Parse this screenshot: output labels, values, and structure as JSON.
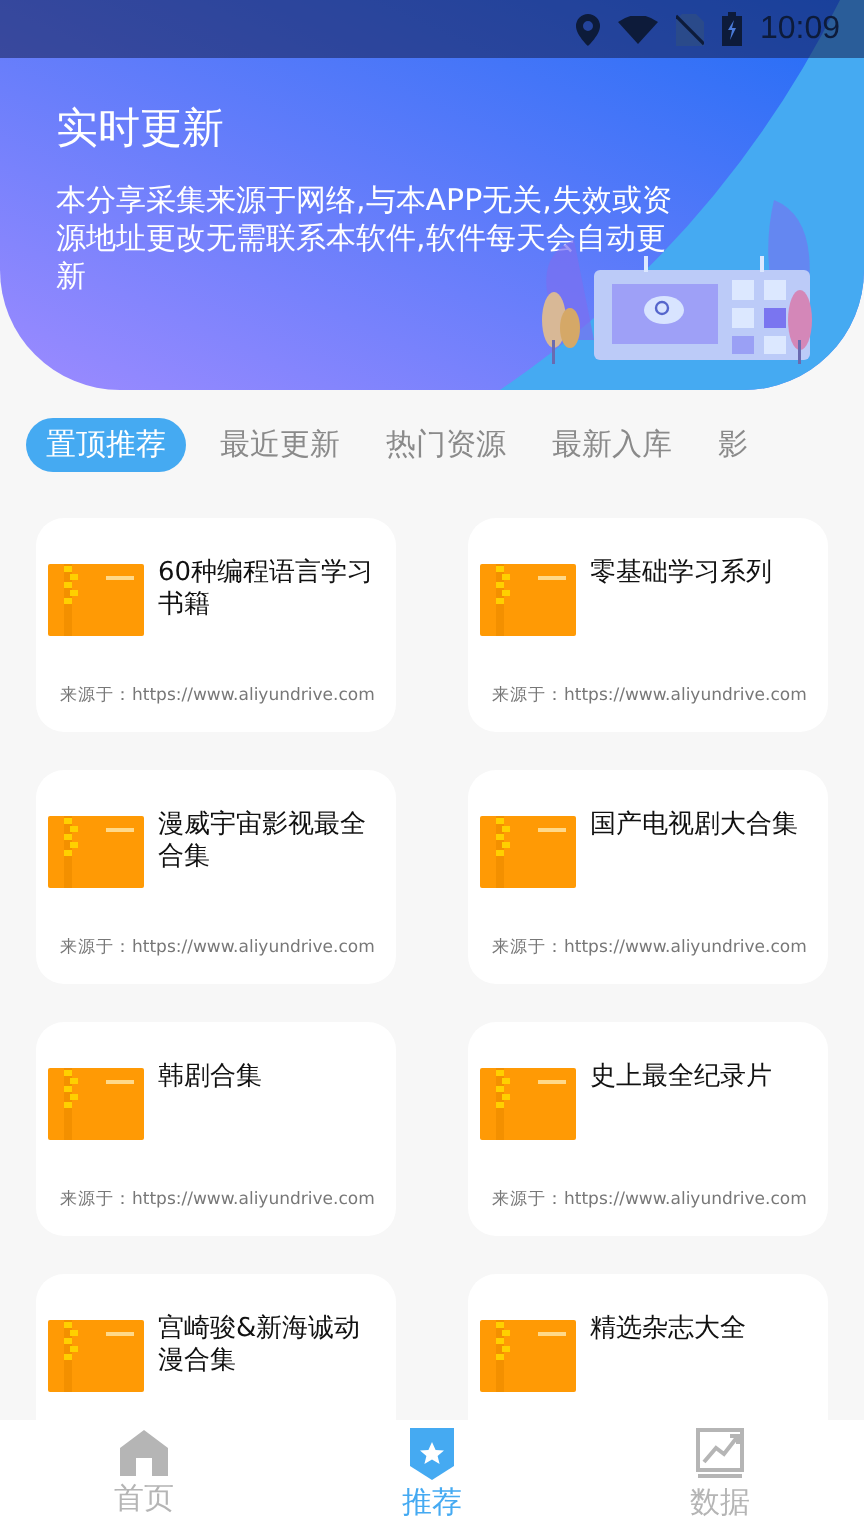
{
  "status_bar": {
    "time": "10:09"
  },
  "header": {
    "title": "实时更新",
    "description": "本分享采集来源于网络,与本APP无关,失效或资源地址更改无需联系本软件,软件每天会自动更新"
  },
  "tabs": [
    {
      "label": "置顶推荐",
      "selected": true
    },
    {
      "label": "最近更新",
      "selected": false
    },
    {
      "label": "热门资源",
      "selected": false
    },
    {
      "label": "最新入库",
      "selected": false
    },
    {
      "label": "影",
      "selected": false
    }
  ],
  "resources": [
    {
      "title": "60种编程语言学习书籍",
      "source": "来源于：https://www.aliyundrive.com"
    },
    {
      "title": "零基础学习系列",
      "source": "来源于：https://www.aliyundrive.com"
    },
    {
      "title": "漫威宇宙影视最全合集",
      "source": "来源于：https://www.aliyundrive.com"
    },
    {
      "title": "国产电视剧大合集",
      "source": "来源于：https://www.aliyundrive.com"
    },
    {
      "title": "韩剧合集",
      "source": "来源于：https://www.aliyundrive.com"
    },
    {
      "title": "史上最全纪录片",
      "source": "来源于：https://www.aliyundrive.com"
    },
    {
      "title": "宫崎骏&新海诚动漫合集"
    },
    {
      "title": "精选杂志大全"
    }
  ],
  "bottom_nav": [
    {
      "label": "首页",
      "kind": "home",
      "selected": false
    },
    {
      "label": "推荐",
      "kind": "badge",
      "selected": true
    },
    {
      "label": "数据",
      "kind": "chart",
      "selected": false
    }
  ]
}
